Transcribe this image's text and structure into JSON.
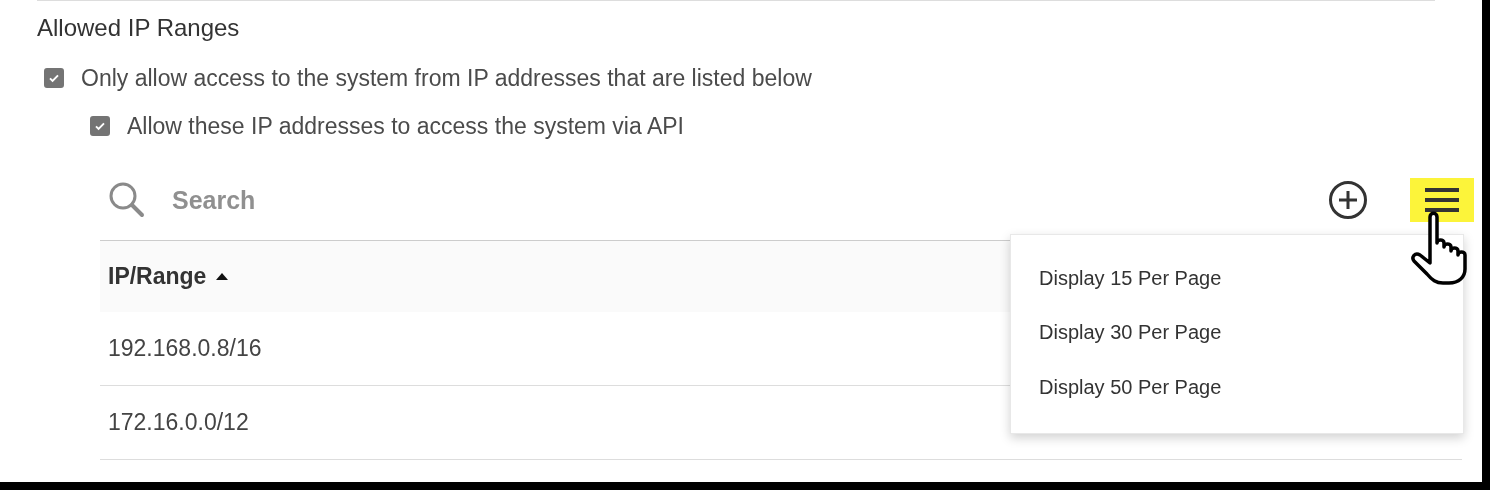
{
  "section": {
    "title": "Allowed IP Ranges"
  },
  "options": [
    {
      "label": "Only allow access to the system from IP addresses that are listed below",
      "checked": true,
      "children": [
        {
          "label": "Allow these IP addresses to access the system via API",
          "checked": true
        }
      ]
    }
  ],
  "toolbar": {
    "search": {
      "placeholder": "Search"
    },
    "menu_button": {
      "highlighted": true
    }
  },
  "table": {
    "columns": [
      {
        "label": "IP/Range",
        "sorted_ascending": true
      }
    ],
    "rows": [
      [
        "192.168.0.8/16"
      ],
      [
        "172.16.0.0/12"
      ]
    ]
  },
  "menu": {
    "items": [
      {
        "label": "Display 15 Per Page"
      },
      {
        "label": "Display 30 Per Page"
      },
      {
        "label": "Display 50 Per Page"
      }
    ]
  }
}
